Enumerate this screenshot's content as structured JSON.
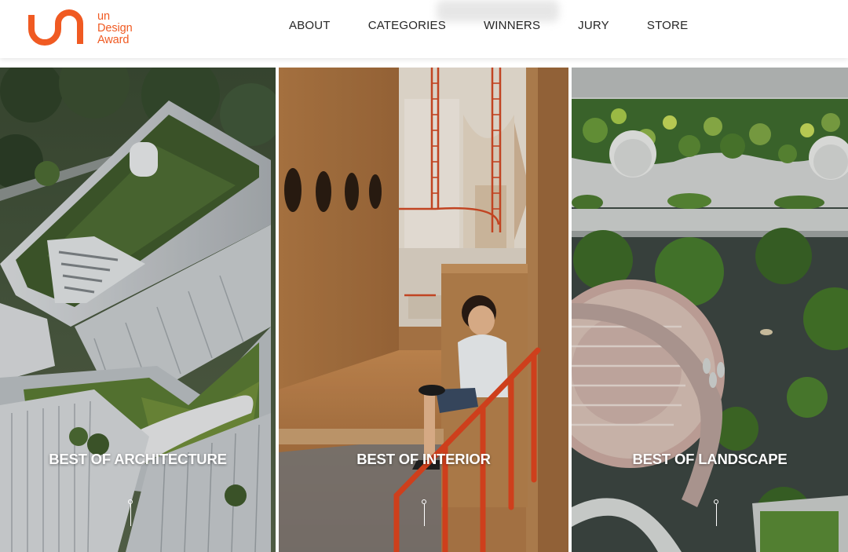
{
  "brand": {
    "logo_line1": "un",
    "logo_line2": "Design",
    "logo_line3": "Award",
    "color": "#f05a22"
  },
  "nav": {
    "items": [
      {
        "label": "ABOUT"
      },
      {
        "label": "CATEGORIES"
      },
      {
        "label": "WINNERS"
      },
      {
        "label": "JURY"
      },
      {
        "label": "STORE"
      }
    ]
  },
  "panels": [
    {
      "label": "BEST OF ARCHITECTURE",
      "scene": "aerial-green-roof-building"
    },
    {
      "label": "BEST OF INTERIOR",
      "scene": "child-on-wooden-bench-with-red-railing"
    },
    {
      "label": "BEST OF LANDSCAPE",
      "scene": "aerial-landscaped-plaza"
    }
  ],
  "icons": {
    "scroll": "scroll-down-indicator-icon"
  }
}
